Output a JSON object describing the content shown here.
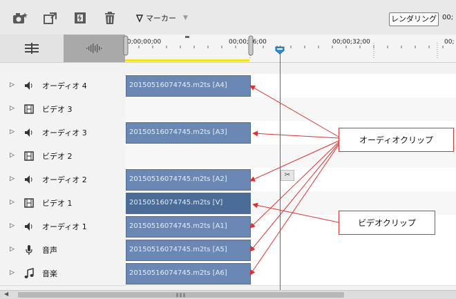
{
  "toolbar": {
    "icons": [
      "camera-snapshot-icon",
      "export-clip-icon",
      "scene-detect-icon",
      "trash-icon"
    ],
    "marker_label": "マーカー",
    "render_label": "レンダリング",
    "timecode_partial": "00;"
  },
  "ruler": {
    "labels": [
      "0;00;00;00",
      "00;00;16;00",
      "00;00;32;00",
      "00;"
    ]
  },
  "tracks": [
    {
      "name": "オーディオ 4",
      "type": "audio",
      "clip": "20150516074745.m2ts [A4]"
    },
    {
      "name": "ビデオ 3",
      "type": "video",
      "clip": ""
    },
    {
      "name": "オーディオ 3",
      "type": "audio",
      "clip": "20150516074745.m2ts [A3]"
    },
    {
      "name": "ビデオ 2",
      "type": "video",
      "clip": ""
    },
    {
      "name": "オーディオ 2",
      "type": "audio",
      "clip": "20150516074745.m2ts [A2]"
    },
    {
      "name": "ビデオ 1",
      "type": "video",
      "clip": "20150516074745.m2ts [V]"
    },
    {
      "name": "オーディオ 1",
      "type": "audio",
      "clip": "20150516074745.m2ts [A1]"
    },
    {
      "name": "音声",
      "type": "narration",
      "clip": "20150516074745.m2ts [A5]"
    },
    {
      "name": "音楽",
      "type": "music",
      "clip": "20150516074745.m2ts [A6]"
    }
  ],
  "callouts": {
    "audio": "オーディオクリップ",
    "video": "ビデオクリップ"
  },
  "colors": {
    "clip": "#6b88b5",
    "clip_video": "#4c6c98",
    "playhead": "#e03030",
    "annotation": "#e03030",
    "work_area": "#f2e21b"
  }
}
